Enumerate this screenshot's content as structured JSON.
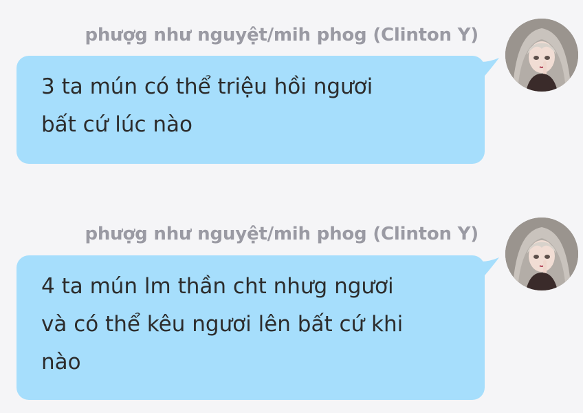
{
  "messages": [
    {
      "sender": "phượg như nguyệt/mih phog (Clinton Y)",
      "text_lines": [
        "3 ta mún có thể triệu hồi ngươi",
        "bất cứ lúc nào"
      ]
    },
    {
      "sender": "phượg như nguyệt/mih phog (Clinton Y)",
      "text_lines": [
        "4 ta mún lm thần cht nhưg ngươi",
        "và có thể kêu ngươi lên bất cứ khi",
        "nào"
      ]
    }
  ],
  "colors": {
    "background": "#f5f5f7",
    "bubble": "#a6defc",
    "sender_text": "#9a9aa3",
    "message_text": "#2c2c2c"
  },
  "icons": {
    "avatar": "anime-girl-avatar"
  }
}
